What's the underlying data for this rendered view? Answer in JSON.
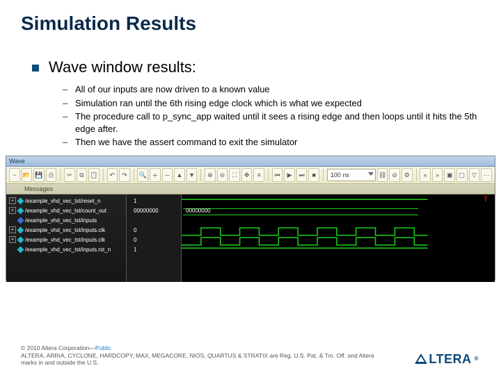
{
  "title": "Simulation Results",
  "bullet1": "Wave window results:",
  "subs": [
    "All of our inputs are now driven to a known value",
    "Simulation ran until the 6th rising edge clock which is what we expected",
    "The procedure call to p_sync_app waited until it sees a rising edge and then loops until it hits the 5th edge after.",
    "Then we have the assert command to exit the simulator"
  ],
  "app": {
    "title": "Wave",
    "messages_label": "Messages",
    "time_field": "100 ns",
    "marker": "T",
    "signals": [
      {
        "name": "/example_vhd_vec_tst/reset_n",
        "value": "1",
        "style": "cyan",
        "plus": true
      },
      {
        "name": "/example_vhd_vec_tst/count_out",
        "value": "00000000",
        "style": "cyan",
        "plus": true
      },
      {
        "name": "/example_vhd_vec_tst/inputs",
        "value": "",
        "style": "blue",
        "plus": false
      },
      {
        "name": "/example_vhd_vec_tst/inputs.clk",
        "value": "0",
        "style": "cyan",
        "plus": true
      },
      {
        "name": "/example_vhd_vec_tst/inputs.clk",
        "value": "0",
        "style": "cyan",
        "plus": true
      },
      {
        "name": "/example_vhd_vec_tst/inputs.rst_n",
        "value": "1",
        "style": "cyan",
        "plus": false
      }
    ],
    "toolbar_icons": [
      "wave-icon",
      "file-open-icon",
      "save-icon",
      "print-icon",
      "cut-icon",
      "copy-icon",
      "paste-icon",
      "undo-icon",
      "redo-icon",
      "find-icon",
      "add-icon",
      "remove-icon",
      "up-icon",
      "down-icon",
      "zoom-in-icon",
      "zoom-out-icon",
      "zoom-full-icon",
      "cursor-icon",
      "ruler-icon",
      "step-back-icon",
      "play-icon",
      "step-fwd-icon",
      "stop-icon",
      "link-icon",
      "break-icon",
      "config-icon",
      "collapse-icon",
      "expand-icon",
      "group-icon",
      "ungroup-icon",
      "filter-icon",
      "options-icon"
    ]
  },
  "footer": {
    "line1a": "© 2010 Altera Corporation—",
    "line1b": "Public",
    "line2": "ALTERA, ARRIA, CYCLONE, HARDCOPY, MAX, MEGACORE, NIOS, QUARTUS & STRATIX are Reg. U.S. Pat. & Tm. Off. and Altera marks in and outside the U.S.",
    "logo_text": "А⌂TERA",
    "logo_reg": "®"
  }
}
